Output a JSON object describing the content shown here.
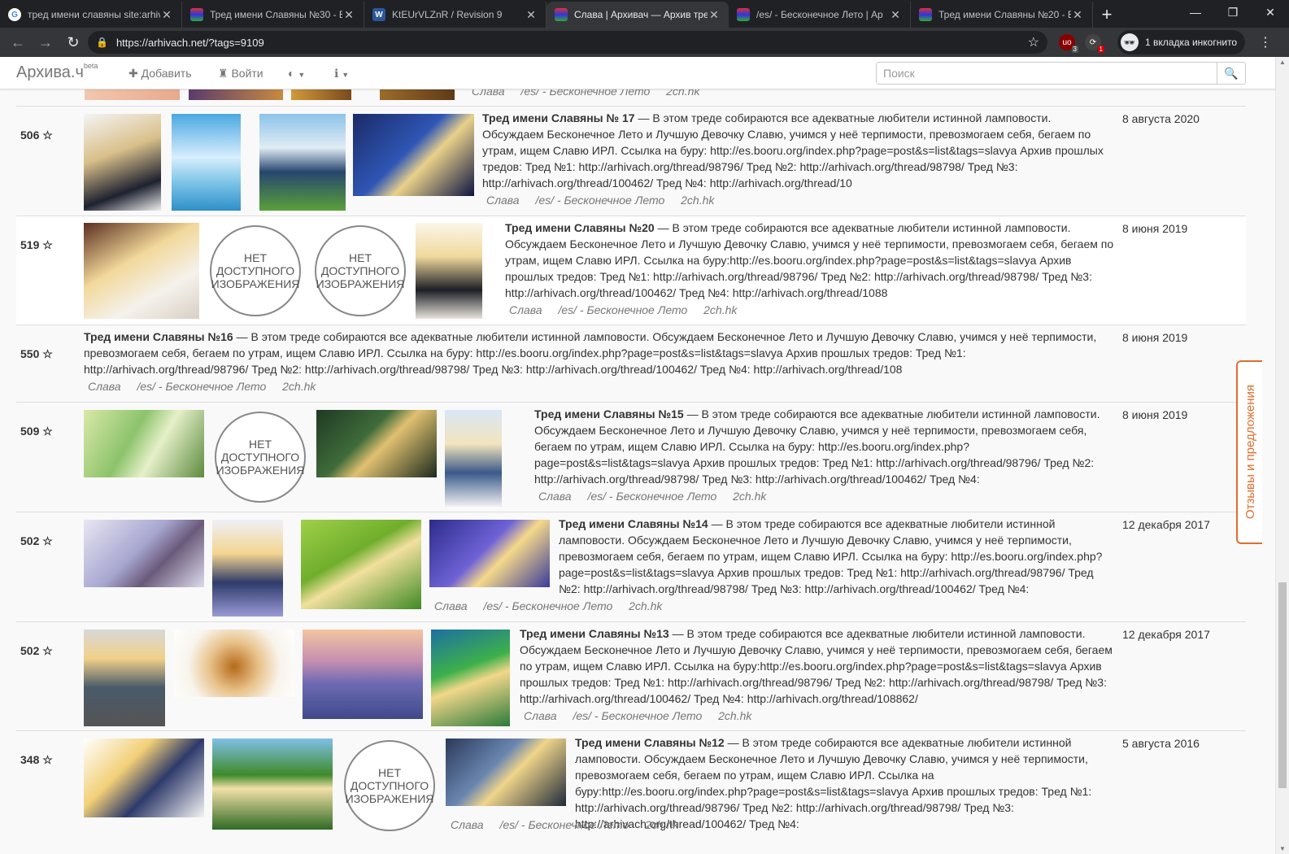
{
  "tabs": [
    {
      "title": "тред имени славяны site:arhiv",
      "color": "#4285f4",
      "letter": "G"
    },
    {
      "title": "Тред имени Славяны №30 - E",
      "color": "#6a3fb5",
      "letter": ""
    },
    {
      "title": "KtEUrVLZnR / Revision 9",
      "color": "#3f6fd8",
      "letter": "W"
    },
    {
      "title": "Слава | Архивач — Архив тре",
      "color": "#6a3fb5",
      "letter": ""
    },
    {
      "title": "/es/ - Бесконечное Лето | Ар",
      "color": "#6a3fb5",
      "letter": ""
    },
    {
      "title": "Тред имени Славяны №20 - E",
      "color": "#6a3fb5",
      "letter": ""
    }
  ],
  "browser": {
    "url": "https://arhivach.net/?tags=9109",
    "incognito": "1 вкладка инкогнито",
    "ext1_badge": "3",
    "ext2_badge": "1"
  },
  "site": {
    "brand": "Архива.ч",
    "beta": "beta",
    "add": "Добавить",
    "login": "Войти",
    "search_placeholder": "Поиск",
    "feedback": "Отзывы и предложения",
    "no_image": "НЕТ ДОСТУПНОГО ИЗОБРАЖЕНИЯ"
  },
  "top_tags": [
    "Слава",
    "/es/ - Бесконечное Лето",
    "2ch.hk"
  ],
  "threads": [
    {
      "score": "506 ☆",
      "title": "Тред имени Славяны № 17",
      "text": " — В этом треде собираются все адекватные любители истинной ламповости. Обсуждаем Бесконечное Лето и Лучшую Девочку Славю, учимся у неё терпимости, превозмогаем себя, бегаем по утрам, ищем Славю ИРЛ. Ссылка на буру: http://es.booru.org/index.php?page=post&s=list&tags=slavya Архив прошлых тредов: Тред №1: http://arhivach.org/thread/98796/ Тред №2: http://arhivach.org/thread/98798/ Тред №3: http://arhivach.org/thread/100462/ Тред №4: http://arhivach.org/thread/10",
      "date": "8 августа 2020",
      "tags": [
        "Слава",
        "/es/ - Бесконечное Лето",
        "2ch.hk"
      ]
    },
    {
      "score": "519 ☆",
      "title": "Тред имени Славяны №20",
      "text": " — В этом треде собираются все адекватные любители истинной ламповости. Обсуждаем Бесконечное Лето и Лучшую Девочку Славю, учимся у неё терпимости, превозмогаем себя, бегаем по утрам, ищем Славю ИРЛ. Ссылка на буру:http://es.booru.org/index.php?page=post&s=list&tags=slavya Архив прошлых тредов: Тред №1: http://arhivach.org/thread/98796/ Тред №2: http://arhivach.org/thread/98798/ Тред №3: http://arhivach.org/thread/100462/ Тред №4: http://arhivach.org/thread/1088",
      "date": "8 июня 2019",
      "tags": [
        "Слава",
        "/es/ - Бесконечное Лето",
        "2ch.hk"
      ]
    },
    {
      "score": "550 ☆",
      "title": "Тред имени Славяны №16",
      "text": " — В этом треде собираются все адекватные любители истинной ламповости. Обсуждаем Бесконечное Лето и Лучшую Девочку Славю, учимся у неё терпимости, превозмогаем себя, бегаем по утрам, ищем Славю ИРЛ. Ссылка на буру: http://es.booru.org/index.php?page=post&s=list&tags=slavya Архив прошлых тредов: Тред №1: http://arhivach.org/thread/98796/ Тред №2: http://arhivach.org/thread/98798/ Тред №3: http://arhivach.org/thread/100462/ Тред №4: http://arhivach.org/thread/108",
      "date": "8 июня 2019",
      "tags": [
        "Слава",
        "/es/ - Бесконечное Лето",
        "2ch.hk"
      ]
    },
    {
      "score": "509 ☆",
      "title": "Тред имени Славяны №15",
      "text": " — В этом треде собираются все адекватные любители истинной ламповости. Обсуждаем Бесконечное Лето и Лучшую Девочку Славю, учимся у неё терпимости, превозмогаем себя, бегаем по утрам, ищем Славю ИРЛ. Ссылка на буру: http://es.booru.org/index.php?page=post&s=list&tags=slavya Архив прошлых тредов: Тред №1: http://arhivach.org/thread/98796/ Тред №2: http://arhivach.org/thread/98798/ Тред №3: http://arhivach.org/thread/100462/ Тред №4:",
      "date": "8 июня 2019",
      "tags": [
        "Слава",
        "/es/ - Бесконечное Лето",
        "2ch.hk"
      ]
    },
    {
      "score": "502 ☆",
      "title": "Тред имени Славяны №14",
      "text": " — В этом треде собираются все адекватные любители истинной ламповости. Обсуждаем Бесконечное Лето и Лучшую Девочку Славю, учимся у неё терпимости, превозмогаем себя, бегаем по утрам, ищем Славю ИРЛ. Ссылка на буру: http://es.booru.org/index.php?page=post&s=list&tags=slavya Архив прошлых тредов: Тред №1: http://arhivach.org/thread/98796/ Тред №2: http://arhivach.org/thread/98798/ Тред №3: http://arhivach.org/thread/100462/ Тред №4:",
      "date": "12 декабря 2017",
      "tags": [
        "Слава",
        "/es/ - Бесконечное Лето",
        "2ch.hk"
      ]
    },
    {
      "score": "502 ☆",
      "title": "Тред имени Славяны №13",
      "text": " — В этом треде собираются все адекватные любители истинной ламповости. Обсуждаем Бесконечное Лето и Лучшую Девочку Славю, учимся у неё терпимости, превозмогаем себя, бегаем по утрам, ищем Славю ИРЛ. Ссылка на буру:http://es.booru.org/index.php?page=post&s=list&tags=slavya Архив прошлых тредов: Тред №1: http://arhivach.org/thread/98796/ Тред №2: http://arhivach.org/thread/98798/ Тред №3: http://arhivach.org/thread/100462/ Тред №4: http://arhivach.org/thread/108862/",
      "date": "12 декабря 2017",
      "tags": [
        "Слава",
        "/es/ - Бесконечное Лето",
        "2ch.hk"
      ]
    },
    {
      "score": "348 ☆",
      "title": "Тред имени Славяны №12",
      "text": " — В этом треде собираются все адекватные любители истинной ламповости. Обсуждаем Бесконечное Лето и Лучшую Девочку Славю, учимся у неё терпимости, превозмогаем себя, бегаем по утрам, ищем Славю ИРЛ. Ссылка на буру:http://es.booru.org/index.php?page=post&s=list&tags=slavya Архив прошлых тредов: Тред №1: http://arhivach.org/thread/98796/ Тред №2: http://arhivach.org/thread/98798/ Тред №3: http://arhivach.org/thread/100462/ Тред №4:",
      "date": "5 августа 2016",
      "tags": [
        "Слава",
        "/es/ - Бесконечное Лето",
        "2ch.hk"
      ]
    }
  ]
}
